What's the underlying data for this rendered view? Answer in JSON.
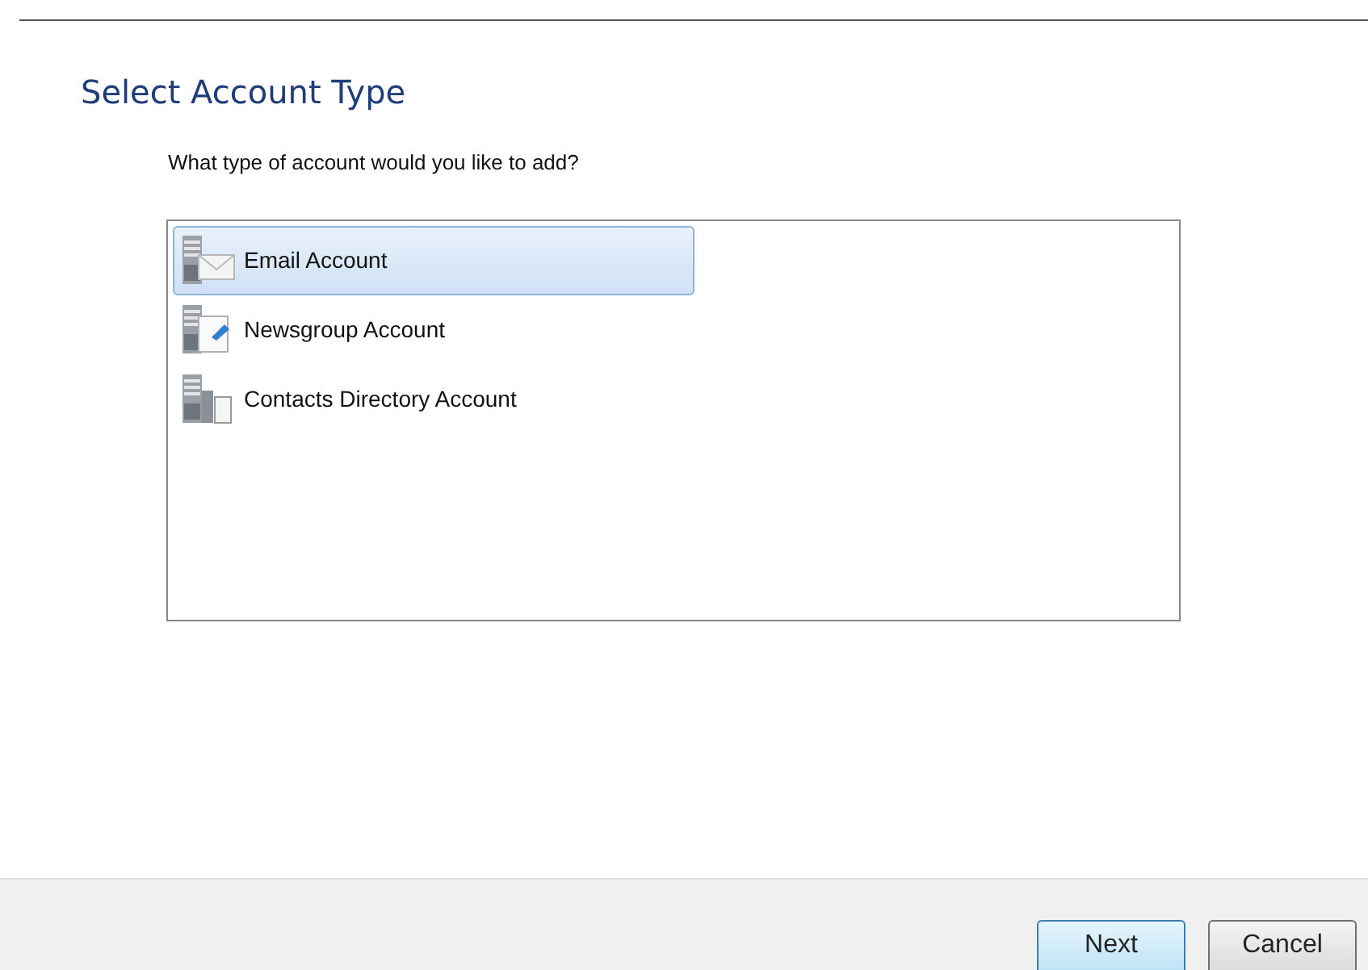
{
  "title": "Select Account Type",
  "question": "What type of account would you like to add?",
  "account_types": [
    {
      "label": "Email Account",
      "kind": "email",
      "selected": true
    },
    {
      "label": "Newsgroup Account",
      "kind": "newsgroup",
      "selected": false
    },
    {
      "label": "Contacts Directory Account",
      "kind": "contacts",
      "selected": false
    }
  ],
  "buttons": [
    {
      "label": "Next",
      "default": true
    },
    {
      "label": "Cancel",
      "default": false
    }
  ]
}
